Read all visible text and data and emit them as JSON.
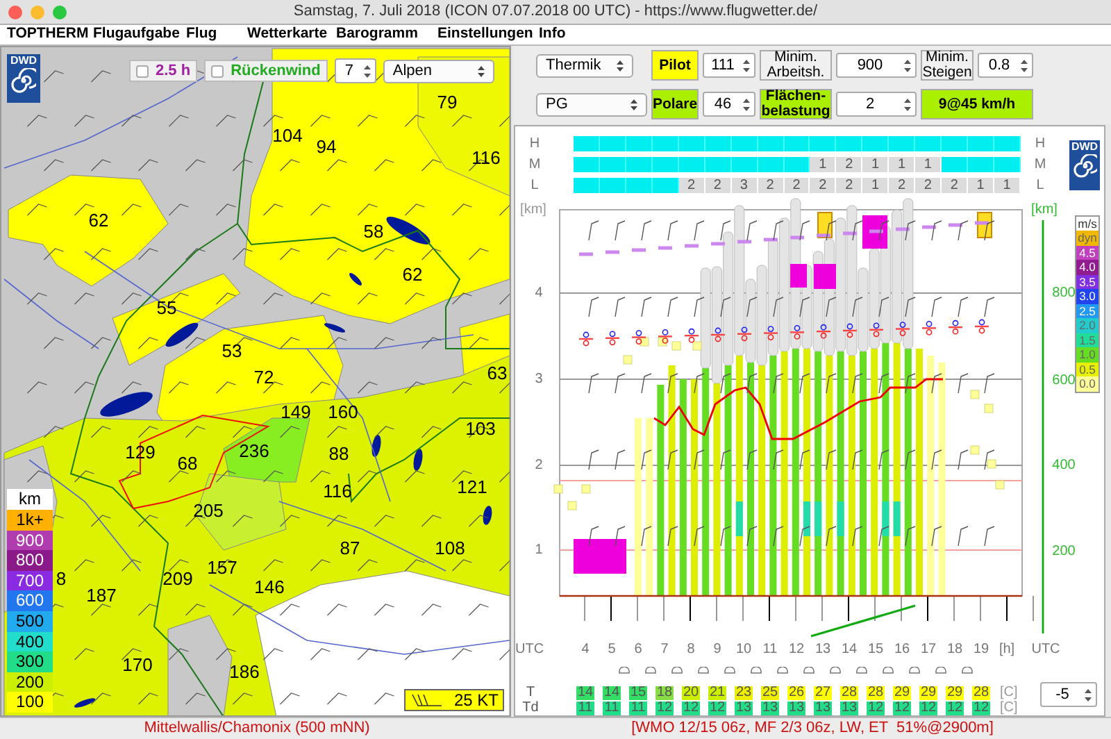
{
  "window": {
    "title": "Samstag, 7. Juli 2018 (ICON 07.07.2018 00 UTC) - https://www.flugwetter.de/"
  },
  "menu": [
    "TOPTHERM",
    "Flugaufgabe",
    "Flug",
    "Wetterkarte",
    "Barogramm",
    "Einstellungen",
    "Info"
  ],
  "map": {
    "logo_text": "DWD",
    "options": [
      {
        "label": "2.5 h",
        "checked": false
      },
      {
        "label": "Rückenwind",
        "checked": false
      }
    ],
    "step_value": "7",
    "region": "Alpen",
    "labels": [
      "79",
      "104",
      "94",
      "116",
      "62",
      "58",
      "62",
      "55",
      "53",
      "72",
      "63",
      "149",
      "160",
      "103",
      "129",
      "68",
      "236",
      "88",
      "121",
      "116",
      "205",
      "87",
      "108",
      "157",
      "8",
      "209",
      "146",
      "187",
      "170",
      "186"
    ],
    "legend": {
      "unit": "km",
      "items": [
        {
          "label": "1k+",
          "color": "#ffb000"
        },
        {
          "label": "900",
          "color": "#b03cb0"
        },
        {
          "label": "800",
          "color": "#8a1a8a"
        },
        {
          "label": "700",
          "color": "#8a2be2"
        },
        {
          "label": "600",
          "color": "#2277ee"
        },
        {
          "label": "500",
          "color": "#22aaee"
        },
        {
          "label": "400",
          "color": "#22ddcc"
        },
        {
          "label": "300",
          "color": "#22dd88"
        },
        {
          "label": "200",
          "color": "#ccee00"
        },
        {
          "label": "100",
          "color": "#ffff00"
        }
      ]
    },
    "wind_scale": "25 KT"
  },
  "controls": {
    "mode": "Thermik",
    "pilot": "Pilot",
    "pilot_value": "111",
    "min_work_label": "Minim. Arbeitsh.",
    "min_work_value": "900",
    "min_climb_label": "Minim. Steigen",
    "min_climb_value": "0.8",
    "glider": "PG",
    "polar": "Polare",
    "polar_value": "46",
    "wing_load_label": "Flächen-belastung",
    "wing_load_value": "2",
    "wind": "9@45 km/h"
  },
  "meteogram": {
    "logo_text": "DWD",
    "cloud_rows": [
      {
        "label": "H",
        "right_label": "H",
        "cells": [
          {
            "kind": "clear"
          },
          {
            "kind": "clear"
          },
          {
            "kind": "clear"
          },
          {
            "kind": "clear"
          },
          {
            "kind": "clear"
          },
          {
            "kind": "clear"
          },
          {
            "kind": "clear"
          },
          {
            "kind": "clear"
          },
          {
            "kind": "clear"
          },
          {
            "kind": "clear"
          },
          {
            "kind": "clear"
          },
          {
            "kind": "clear"
          },
          {
            "kind": "clear"
          },
          {
            "kind": "clear"
          },
          {
            "kind": "clear"
          },
          {
            "kind": "clear"
          },
          {
            "kind": "clear"
          }
        ]
      },
      {
        "label": "M",
        "right_label": "M",
        "cells": [
          {
            "kind": "clear"
          },
          {
            "kind": "clear"
          },
          {
            "kind": "clear"
          },
          {
            "kind": "clear"
          },
          {
            "kind": "clear"
          },
          {
            "kind": "clear"
          },
          {
            "kind": "clear"
          },
          {
            "kind": "clear"
          },
          {
            "kind": "clear"
          },
          {
            "kind": "cloud",
            "text": "1"
          },
          {
            "kind": "cloud",
            "text": "2"
          },
          {
            "kind": "cloud",
            "text": "1"
          },
          {
            "kind": "cloud",
            "text": "1"
          },
          {
            "kind": "cloud",
            "text": "1"
          },
          {
            "kind": "clear"
          },
          {
            "kind": "clear"
          },
          {
            "kind": "clear"
          }
        ]
      },
      {
        "label": "L",
        "right_label": "L",
        "cells": [
          {
            "kind": "clear"
          },
          {
            "kind": "clear"
          },
          {
            "kind": "clear"
          },
          {
            "kind": "clear"
          },
          {
            "kind": "cloud",
            "text": "2"
          },
          {
            "kind": "cloud",
            "text": "2"
          },
          {
            "kind": "cloud",
            "text": "3"
          },
          {
            "kind": "cloud",
            "text": "2"
          },
          {
            "kind": "cloud",
            "text": "2"
          },
          {
            "kind": "cloud",
            "text": "2"
          },
          {
            "kind": "cloud",
            "text": "2"
          },
          {
            "kind": "cloud",
            "text": "1"
          },
          {
            "kind": "cloud",
            "text": "2"
          },
          {
            "kind": "cloud",
            "text": "2"
          },
          {
            "kind": "cloud",
            "text": "2"
          },
          {
            "kind": "cloud",
            "text": "1"
          },
          {
            "kind": "cloud",
            "text": "1"
          }
        ]
      }
    ],
    "left_axis": {
      "unit": "[km]",
      "ticks": [
        "4",
        "3",
        "2",
        "1"
      ]
    },
    "right_axis": {
      "unit": "[km]",
      "ticks": [
        "800",
        "600",
        "400",
        "200"
      ]
    },
    "climb_legend": {
      "unit": "m/s",
      "items": [
        {
          "label": "dyn",
          "color": "#f0b800"
        },
        {
          "label": "4.5",
          "color": "#c040c0"
        },
        {
          "label": "4.0",
          "color": "#901c90"
        },
        {
          "label": "3.5",
          "color": "#8030e0"
        },
        {
          "label": "3.0",
          "color": "#2244ee"
        },
        {
          "label": "2.5",
          "color": "#2299ee"
        },
        {
          "label": "2.0",
          "color": "#22cccc"
        },
        {
          "label": "1.5",
          "color": "#22dd99"
        },
        {
          "label": "1.0",
          "color": "#66dd22"
        },
        {
          "label": "0.5",
          "color": "#e6f000"
        },
        {
          "label": "0.0",
          "color": "#ffff99"
        }
      ]
    },
    "time_axis": {
      "left_label": "UTC",
      "hours": [
        "4",
        "5",
        "6",
        "7",
        "8",
        "9",
        "10",
        "11",
        "12",
        "13",
        "14",
        "15",
        "16",
        "17",
        "18",
        "19"
      ],
      "unit": "[h]",
      "right_label": "UTC"
    },
    "temperature": {
      "label": "T",
      "unit": "[C]",
      "values": [
        {
          "text": "14",
          "color": "#33dd66"
        },
        {
          "text": "14",
          "color": "#33dd66"
        },
        {
          "text": "15",
          "color": "#33dd66"
        },
        {
          "text": "18",
          "color": "#88dd44"
        },
        {
          "text": "20",
          "color": "#ccee00"
        },
        {
          "text": "21",
          "color": "#ccee00"
        },
        {
          "text": "23",
          "color": "#eeee00"
        },
        {
          "text": "25",
          "color": "#eeee00"
        },
        {
          "text": "26",
          "color": "#ffff00"
        },
        {
          "text": "27",
          "color": "#ffff00"
        },
        {
          "text": "28",
          "color": "#ffff00"
        },
        {
          "text": "28",
          "color": "#ffff00"
        },
        {
          "text": "29",
          "color": "#ffff00"
        },
        {
          "text": "29",
          "color": "#ffff00"
        },
        {
          "text": "29",
          "color": "#ffff00"
        },
        {
          "text": "28",
          "color": "#ffff00"
        }
      ]
    },
    "dewpoint": {
      "label": "Td",
      "unit": "[C]",
      "values": [
        {
          "text": "11",
          "color": "#22dd88"
        },
        {
          "text": "11",
          "color": "#22dd88"
        },
        {
          "text": "11",
          "color": "#22dd88"
        },
        {
          "text": "12",
          "color": "#22dd88"
        },
        {
          "text": "12",
          "color": "#22dd88"
        },
        {
          "text": "12",
          "color": "#22dd88"
        },
        {
          "text": "13",
          "color": "#22dd88"
        },
        {
          "text": "13",
          "color": "#22dd88"
        },
        {
          "text": "13",
          "color": "#22dd88"
        },
        {
          "text": "13",
          "color": "#22dd88"
        },
        {
          "text": "13",
          "color": "#22dd88"
        },
        {
          "text": "12",
          "color": "#22dd88"
        },
        {
          "text": "12",
          "color": "#22dd88"
        },
        {
          "text": "12",
          "color": "#22dd88"
        },
        {
          "text": "12",
          "color": "#22dd88"
        },
        {
          "text": "12",
          "color": "#22dd88"
        }
      ]
    },
    "offset_value": "-5"
  },
  "status_bar": {
    "left": "Mittelwallis/Chamonix (500 mNN)",
    "right": "[WMO 12/15 06z, MF 2/3 06z, LW, ET  51%@2900m]"
  }
}
